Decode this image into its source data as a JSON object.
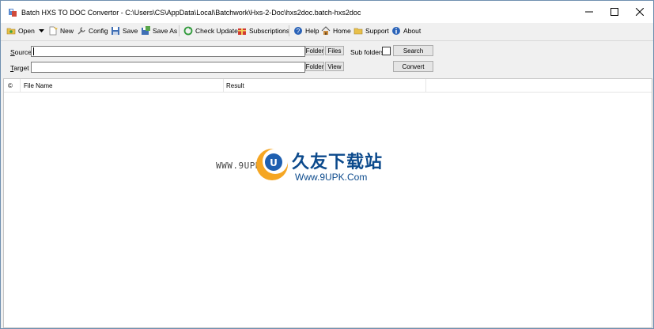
{
  "window": {
    "title": "Batch HXS TO DOC Convertor - C:\\Users\\CS\\AppData\\Local\\Batchwork\\Hxs-2-Doc\\hxs2doc.batch-hxs2doc"
  },
  "toolbar": {
    "open": "Open",
    "new": "New",
    "config": "Config",
    "save": "Save",
    "save_as": "Save As",
    "check_update": "Check Update",
    "subscriptions": "Subscriptions",
    "help": "Help",
    "home": "Home",
    "support": "Support",
    "about": "About"
  },
  "form": {
    "source_label_underlined": "S",
    "source_label_rest": "ource",
    "target_label_underlined": "T",
    "target_label_rest": "arget",
    "source_value": "",
    "target_value": "",
    "folder_button": "Folder",
    "files_button": "Files",
    "view_button": "View",
    "subfolders_label": "Sub folders",
    "subfolders_checked": false,
    "search_button": "Search",
    "convert_button": "Convert"
  },
  "list": {
    "columns": [
      "©",
      "File Name",
      "Result"
    ],
    "rows": []
  },
  "watermark": {
    "url_left": "WWW.9UPK.COM",
    "brand_cn": "久友下载站",
    "url_right": "Www.9UPK.Com"
  },
  "colors": {
    "watermark_blue": "#0c4a8c",
    "watermark_orange": "#f5a623"
  }
}
